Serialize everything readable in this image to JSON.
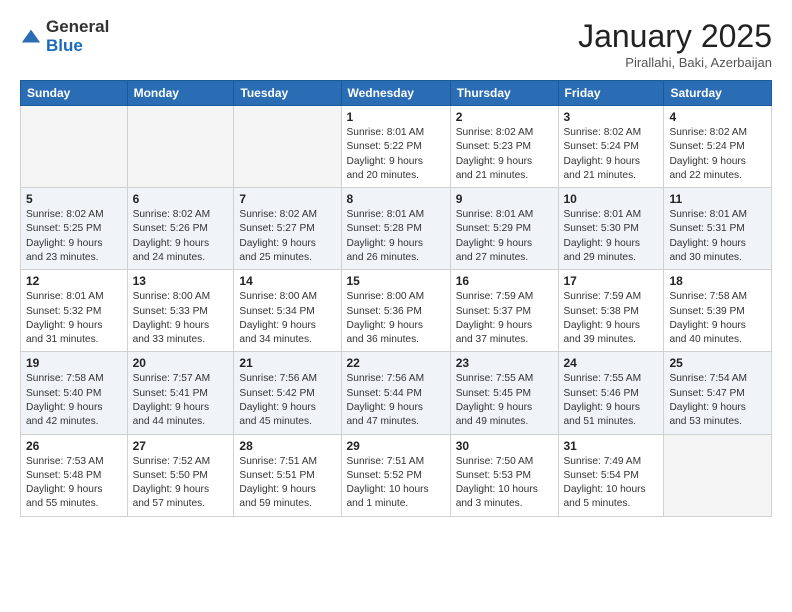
{
  "header": {
    "logo_general": "General",
    "logo_blue": "Blue",
    "month_title": "January 2025",
    "location": "Pirallahi, Baki, Azerbaijan"
  },
  "weekdays": [
    "Sunday",
    "Monday",
    "Tuesday",
    "Wednesday",
    "Thursday",
    "Friday",
    "Saturday"
  ],
  "weeks": [
    {
      "alt": false,
      "days": [
        {
          "num": "",
          "info": ""
        },
        {
          "num": "",
          "info": ""
        },
        {
          "num": "",
          "info": ""
        },
        {
          "num": "1",
          "info": "Sunrise: 8:01 AM\nSunset: 5:22 PM\nDaylight: 9 hours\nand 20 minutes."
        },
        {
          "num": "2",
          "info": "Sunrise: 8:02 AM\nSunset: 5:23 PM\nDaylight: 9 hours\nand 21 minutes."
        },
        {
          "num": "3",
          "info": "Sunrise: 8:02 AM\nSunset: 5:24 PM\nDaylight: 9 hours\nand 21 minutes."
        },
        {
          "num": "4",
          "info": "Sunrise: 8:02 AM\nSunset: 5:24 PM\nDaylight: 9 hours\nand 22 minutes."
        }
      ]
    },
    {
      "alt": true,
      "days": [
        {
          "num": "5",
          "info": "Sunrise: 8:02 AM\nSunset: 5:25 PM\nDaylight: 9 hours\nand 23 minutes."
        },
        {
          "num": "6",
          "info": "Sunrise: 8:02 AM\nSunset: 5:26 PM\nDaylight: 9 hours\nand 24 minutes."
        },
        {
          "num": "7",
          "info": "Sunrise: 8:02 AM\nSunset: 5:27 PM\nDaylight: 9 hours\nand 25 minutes."
        },
        {
          "num": "8",
          "info": "Sunrise: 8:01 AM\nSunset: 5:28 PM\nDaylight: 9 hours\nand 26 minutes."
        },
        {
          "num": "9",
          "info": "Sunrise: 8:01 AM\nSunset: 5:29 PM\nDaylight: 9 hours\nand 27 minutes."
        },
        {
          "num": "10",
          "info": "Sunrise: 8:01 AM\nSunset: 5:30 PM\nDaylight: 9 hours\nand 29 minutes."
        },
        {
          "num": "11",
          "info": "Sunrise: 8:01 AM\nSunset: 5:31 PM\nDaylight: 9 hours\nand 30 minutes."
        }
      ]
    },
    {
      "alt": false,
      "days": [
        {
          "num": "12",
          "info": "Sunrise: 8:01 AM\nSunset: 5:32 PM\nDaylight: 9 hours\nand 31 minutes."
        },
        {
          "num": "13",
          "info": "Sunrise: 8:00 AM\nSunset: 5:33 PM\nDaylight: 9 hours\nand 33 minutes."
        },
        {
          "num": "14",
          "info": "Sunrise: 8:00 AM\nSunset: 5:34 PM\nDaylight: 9 hours\nand 34 minutes."
        },
        {
          "num": "15",
          "info": "Sunrise: 8:00 AM\nSunset: 5:36 PM\nDaylight: 9 hours\nand 36 minutes."
        },
        {
          "num": "16",
          "info": "Sunrise: 7:59 AM\nSunset: 5:37 PM\nDaylight: 9 hours\nand 37 minutes."
        },
        {
          "num": "17",
          "info": "Sunrise: 7:59 AM\nSunset: 5:38 PM\nDaylight: 9 hours\nand 39 minutes."
        },
        {
          "num": "18",
          "info": "Sunrise: 7:58 AM\nSunset: 5:39 PM\nDaylight: 9 hours\nand 40 minutes."
        }
      ]
    },
    {
      "alt": true,
      "days": [
        {
          "num": "19",
          "info": "Sunrise: 7:58 AM\nSunset: 5:40 PM\nDaylight: 9 hours\nand 42 minutes."
        },
        {
          "num": "20",
          "info": "Sunrise: 7:57 AM\nSunset: 5:41 PM\nDaylight: 9 hours\nand 44 minutes."
        },
        {
          "num": "21",
          "info": "Sunrise: 7:56 AM\nSunset: 5:42 PM\nDaylight: 9 hours\nand 45 minutes."
        },
        {
          "num": "22",
          "info": "Sunrise: 7:56 AM\nSunset: 5:44 PM\nDaylight: 9 hours\nand 47 minutes."
        },
        {
          "num": "23",
          "info": "Sunrise: 7:55 AM\nSunset: 5:45 PM\nDaylight: 9 hours\nand 49 minutes."
        },
        {
          "num": "24",
          "info": "Sunrise: 7:55 AM\nSunset: 5:46 PM\nDaylight: 9 hours\nand 51 minutes."
        },
        {
          "num": "25",
          "info": "Sunrise: 7:54 AM\nSunset: 5:47 PM\nDaylight: 9 hours\nand 53 minutes."
        }
      ]
    },
    {
      "alt": false,
      "days": [
        {
          "num": "26",
          "info": "Sunrise: 7:53 AM\nSunset: 5:48 PM\nDaylight: 9 hours\nand 55 minutes."
        },
        {
          "num": "27",
          "info": "Sunrise: 7:52 AM\nSunset: 5:50 PM\nDaylight: 9 hours\nand 57 minutes."
        },
        {
          "num": "28",
          "info": "Sunrise: 7:51 AM\nSunset: 5:51 PM\nDaylight: 9 hours\nand 59 minutes."
        },
        {
          "num": "29",
          "info": "Sunrise: 7:51 AM\nSunset: 5:52 PM\nDaylight: 10 hours\nand 1 minute."
        },
        {
          "num": "30",
          "info": "Sunrise: 7:50 AM\nSunset: 5:53 PM\nDaylight: 10 hours\nand 3 minutes."
        },
        {
          "num": "31",
          "info": "Sunrise: 7:49 AM\nSunset: 5:54 PM\nDaylight: 10 hours\nand 5 minutes."
        },
        {
          "num": "",
          "info": ""
        }
      ]
    }
  ]
}
